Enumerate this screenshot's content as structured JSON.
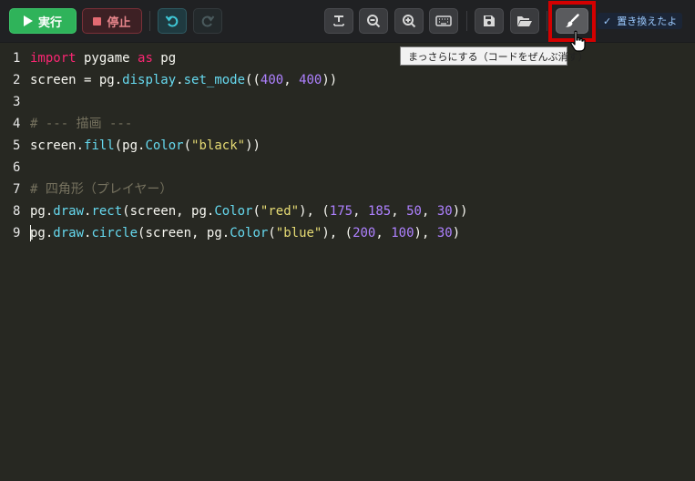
{
  "toolbar": {
    "run_label": "実行",
    "stop_label": "停止",
    "status_check": "✓",
    "status_text": "置き換えたよ"
  },
  "tooltip": {
    "text": "まっさらにする（コードをぜんぶ消す）"
  },
  "editor": {
    "lines": [
      {
        "num": "1",
        "parts": [
          {
            "t": "kw",
            "v": "import"
          },
          {
            "t": "pl",
            "v": " pygame "
          },
          {
            "t": "kw",
            "v": "as"
          },
          {
            "t": "pl",
            "v": " pg"
          }
        ]
      },
      {
        "num": "2",
        "parts": [
          {
            "t": "pl",
            "v": "screen = pg."
          },
          {
            "t": "fn",
            "v": "display"
          },
          {
            "t": "pl",
            "v": "."
          },
          {
            "t": "fn",
            "v": "set_mode"
          },
          {
            "t": "pl",
            "v": "(("
          },
          {
            "t": "num",
            "v": "400"
          },
          {
            "t": "pl",
            "v": ", "
          },
          {
            "t": "num",
            "v": "400"
          },
          {
            "t": "pl",
            "v": "))"
          }
        ]
      },
      {
        "num": "3",
        "parts": []
      },
      {
        "num": "4",
        "parts": [
          {
            "t": "cm",
            "v": "# --- 描画 ---"
          }
        ]
      },
      {
        "num": "5",
        "parts": [
          {
            "t": "pl",
            "v": "screen."
          },
          {
            "t": "fn",
            "v": "fill"
          },
          {
            "t": "pl",
            "v": "(pg."
          },
          {
            "t": "fn",
            "v": "Color"
          },
          {
            "t": "pl",
            "v": "("
          },
          {
            "t": "str",
            "v": "\"black\""
          },
          {
            "t": "pl",
            "v": "))"
          }
        ]
      },
      {
        "num": "6",
        "parts": []
      },
      {
        "num": "7",
        "parts": [
          {
            "t": "cm",
            "v": "# 四角形（プレイヤー）"
          }
        ]
      },
      {
        "num": "8",
        "parts": [
          {
            "t": "pl",
            "v": "pg."
          },
          {
            "t": "fn",
            "v": "draw"
          },
          {
            "t": "pl",
            "v": "."
          },
          {
            "t": "fn",
            "v": "rect"
          },
          {
            "t": "pl",
            "v": "(screen, pg."
          },
          {
            "t": "fn",
            "v": "Color"
          },
          {
            "t": "pl",
            "v": "("
          },
          {
            "t": "str",
            "v": "\"red\""
          },
          {
            "t": "pl",
            "v": "), ("
          },
          {
            "t": "num",
            "v": "175"
          },
          {
            "t": "pl",
            "v": ", "
          },
          {
            "t": "num",
            "v": "185"
          },
          {
            "t": "pl",
            "v": ", "
          },
          {
            "t": "num",
            "v": "50"
          },
          {
            "t": "pl",
            "v": ", "
          },
          {
            "t": "num",
            "v": "30"
          },
          {
            "t": "pl",
            "v": "))"
          }
        ]
      },
      {
        "num": "9",
        "parts": [
          {
            "t": "pl",
            "v": "pg."
          },
          {
            "t": "fn",
            "v": "draw"
          },
          {
            "t": "pl",
            "v": "."
          },
          {
            "t": "fn",
            "v": "circle"
          },
          {
            "t": "pl",
            "v": "(screen, pg."
          },
          {
            "t": "fn",
            "v": "Color"
          },
          {
            "t": "pl",
            "v": "("
          },
          {
            "t": "str",
            "v": "\"blue\""
          },
          {
            "t": "pl",
            "v": "), ("
          },
          {
            "t": "num",
            "v": "200"
          },
          {
            "t": "pl",
            "v": ", "
          },
          {
            "t": "num",
            "v": "100"
          },
          {
            "t": "pl",
            "v": "), "
          },
          {
            "t": "num",
            "v": "30"
          },
          {
            "t": "pl",
            "v": ")"
          }
        ]
      }
    ]
  }
}
